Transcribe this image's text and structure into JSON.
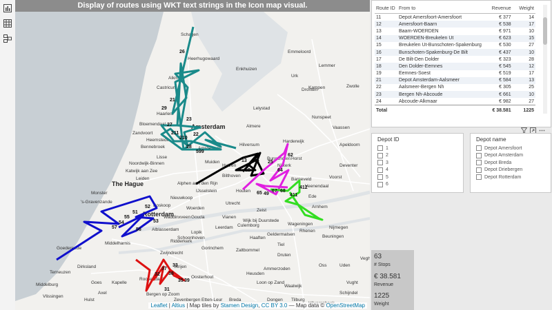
{
  "map": {
    "title": "Display of routes using WKT text strings in the Icon map visual.",
    "attribution": {
      "leaflet": "Leaflet",
      "sep1": " | ",
      "altius": "Altius",
      "tiles_prefix": " | Map tiles by ",
      "stamen": "Stamen Design",
      "sep2": ", ",
      "license": "CC BY 3.0",
      "data_prefix": " — Map data © ",
      "osm": "OpenStreetMap"
    },
    "cities": [
      "Schagen",
      "Heerhugowaard",
      "Alkmaar",
      "Castricum",
      "Enkhuizen",
      "Emmeloord",
      "Lelystad",
      "Kampen",
      "Zwolle",
      "Almere",
      "Hilversum",
      "Amstelveen",
      "Haarlem",
      "Bloemendaal",
      "Zandvoort",
      "Heemstede",
      "Bennebroek",
      "Lisse",
      "Noordwijk-Binnen",
      "Katwijk aan Zee",
      "Leiden",
      "Alphen aan den Rijn",
      "Nieuwkoop",
      "Boskoop",
      "Woerden",
      "Utrecht",
      "Zeist",
      "Nijkerk",
      "Harderwijk",
      "Horst",
      "Apeldoorn",
      "Deventer",
      "Voorst",
      "Arnhem",
      "Nijmegen",
      "Ede",
      "Veenendaal",
      "Wageningen",
      "Tiel",
      "Rhenen",
      "Beuningen",
      "Druten",
      "Leerdam",
      "Culemborg",
      "Vianen",
      "Gorinchem",
      "Zaltbommel",
      "Schoonhoven",
      "Lopik",
      "Waddinxveen",
      "Gouda",
      "Monster",
      "'s-Gravenzande",
      "Ridderkerk",
      "Zwijndrecht",
      "Strijen",
      "Goedereede",
      "Middelharnis",
      "Dirksland",
      "Oosterhout",
      "Roosendaal",
      "Bergen op Zoom",
      "Middelburg",
      "Vlissingen",
      "Oss",
      "Uden",
      "Veghel",
      "Vught",
      "Schijndel",
      "Waalwijk",
      "Dongen",
      "Tilburg",
      "Breda",
      "Etten-Leur",
      "Zevenbergen",
      "Lemmer",
      "Urk",
      "Dronten",
      "Bunschoten",
      "Nunspeet",
      "Vaassen",
      "Bilthoven",
      "Huizen",
      "Muiden",
      "Barneveld",
      "Wijk bij Duurstede",
      "Houten",
      "IJsselstein",
      "Alblasserdam",
      "Geldermalsen",
      "Haaften",
      "Ammerzoden",
      "Heusden",
      "Loon op Zand",
      "Hilvarenbeek",
      "Terneuzen",
      "Hulst",
      "Axel",
      "Kapelle",
      "Goes"
    ],
    "big_cities": [
      "Amsterdam",
      "The Hague",
      "Rotterdam"
    ],
    "stop_labels": [
      "26",
      "21",
      "29",
      "27",
      "23",
      "211",
      "210",
      "22",
      "28",
      "599",
      "13",
      "24",
      "12",
      "25",
      "62",
      "64",
      "65",
      "49",
      "67",
      "68",
      "412",
      "411",
      "52",
      "51",
      "53",
      "55",
      "57",
      "56",
      "54",
      "32",
      "38",
      "35",
      "31",
      "39",
      "37",
      "33"
    ]
  },
  "table": {
    "columns": [
      "Route ID",
      "From to",
      "Revenue",
      "Weight"
    ],
    "rows": [
      [
        "11",
        "Depot Amersfoort-Amersfoort",
        "€ 377",
        "14"
      ],
      [
        "12",
        "Amersfoort-Baarn",
        "€ 538",
        "17"
      ],
      [
        "13",
        "Baarn-WOERDEN",
        "€ 971",
        "10"
      ],
      [
        "14",
        "WOERDEN-Breukelen Ut",
        "€ 623",
        "15"
      ],
      [
        "15",
        "Breukelen Ut-Bunschoten-Spakenburg",
        "€ 530",
        "27"
      ],
      [
        "16",
        "Bunschoten-Spakenburg-De Bilt",
        "€ 437",
        "10"
      ],
      [
        "17",
        "De Bilt-Den Dolder",
        "€ 323",
        "28"
      ],
      [
        "18",
        "Den Dolder-Eemnes",
        "€ 545",
        "12"
      ],
      [
        "19",
        "Eemnes-Soest",
        "€ 519",
        "17"
      ],
      [
        "21",
        "Depot Amsterdam-Aalsmeer",
        "€ 584",
        "13"
      ],
      [
        "22",
        "Aalsmeer-Bergen Nh",
        "€ 305",
        "25"
      ],
      [
        "23",
        "Bergen Nh-Abcoude",
        "€ 661",
        "10"
      ],
      [
        "24",
        "Abcoude-Alkmaar",
        "€ 982",
        "27"
      ]
    ],
    "total": [
      "Total",
      "",
      "€ 38.581",
      "1225"
    ]
  },
  "slicers": {
    "depot_id": {
      "title": "Depot ID",
      "items": [
        "1",
        "2",
        "3",
        "4",
        "5",
        "6"
      ]
    },
    "depot_name": {
      "title": "Depot name",
      "items": [
        "Depot Amersfoort",
        "Depot Amsterdam",
        "Depot Breda",
        "Depot Driebergen",
        "Depot Rotterdam"
      ]
    }
  },
  "kpi": {
    "stops_value": "63",
    "stops_label": "# Stops",
    "revenue_value": "€ 38.581",
    "revenue_label": "Revenue",
    "weight_value": "1225",
    "weight_label": "Weight"
  },
  "colors": {
    "route_teal": "#1a8a8a",
    "route_black": "#000000",
    "route_magenta": "#e020e0",
    "route_green": "#33dd22",
    "route_blue": "#1010cc",
    "route_red": "#dd1111",
    "water": "#dfe3e6",
    "land": "#f2f1ee",
    "sea": "#c8cfd4"
  },
  "icons": {
    "report": "bar-chart-icon",
    "data": "table-grid-icon",
    "model": "model-diagram-icon",
    "filter": "filter-icon",
    "focus": "focus-mode-icon",
    "more": "more-options-icon"
  }
}
